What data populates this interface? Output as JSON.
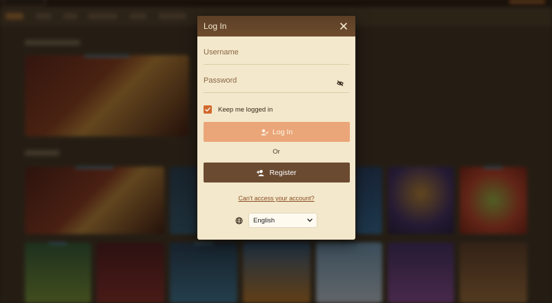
{
  "modal": {
    "title": "Log In",
    "username_placeholder": "Username",
    "password_placeholder": "Password",
    "remember_label": "Keep me logged in",
    "remember_checked": true,
    "login_label": "Log In",
    "or_label": "Or",
    "register_label": "Register",
    "forgot_label": "Can't access your account?",
    "language": {
      "selected": "English"
    }
  },
  "icons": {
    "close": "close-icon",
    "eye_off": "eye-off-icon",
    "check": "check-icon",
    "user_login": "user-login-icon",
    "user_add": "user-add-icon",
    "globe": "globe-icon",
    "chevron": "chevron-down-icon"
  },
  "colors": {
    "header_bg": "#654529",
    "modal_bg": "#f3e8cc",
    "accent_orange": "#d06a2c",
    "login_button": "#eaa679",
    "register_button": "#6a4a30",
    "link": "#8a4e22"
  }
}
